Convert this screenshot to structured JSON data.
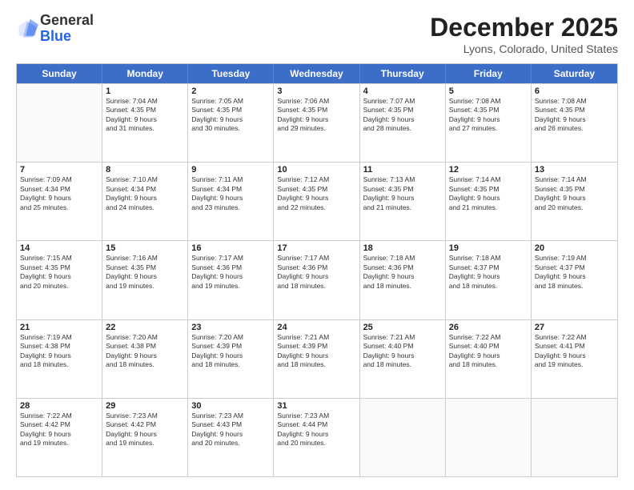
{
  "logo": {
    "line1": "General",
    "line2": "Blue"
  },
  "title": "December 2025",
  "location": "Lyons, Colorado, United States",
  "weekdays": [
    "Sunday",
    "Monday",
    "Tuesday",
    "Wednesday",
    "Thursday",
    "Friday",
    "Saturday"
  ],
  "weeks": [
    [
      {
        "day": "",
        "info": ""
      },
      {
        "day": "1",
        "info": "Sunrise: 7:04 AM\nSunset: 4:35 PM\nDaylight: 9 hours\nand 31 minutes."
      },
      {
        "day": "2",
        "info": "Sunrise: 7:05 AM\nSunset: 4:35 PM\nDaylight: 9 hours\nand 30 minutes."
      },
      {
        "day": "3",
        "info": "Sunrise: 7:06 AM\nSunset: 4:35 PM\nDaylight: 9 hours\nand 29 minutes."
      },
      {
        "day": "4",
        "info": "Sunrise: 7:07 AM\nSunset: 4:35 PM\nDaylight: 9 hours\nand 28 minutes."
      },
      {
        "day": "5",
        "info": "Sunrise: 7:08 AM\nSunset: 4:35 PM\nDaylight: 9 hours\nand 27 minutes."
      },
      {
        "day": "6",
        "info": "Sunrise: 7:08 AM\nSunset: 4:35 PM\nDaylight: 9 hours\nand 26 minutes."
      }
    ],
    [
      {
        "day": "7",
        "info": "Sunrise: 7:09 AM\nSunset: 4:34 PM\nDaylight: 9 hours\nand 25 minutes."
      },
      {
        "day": "8",
        "info": "Sunrise: 7:10 AM\nSunset: 4:34 PM\nDaylight: 9 hours\nand 24 minutes."
      },
      {
        "day": "9",
        "info": "Sunrise: 7:11 AM\nSunset: 4:34 PM\nDaylight: 9 hours\nand 23 minutes."
      },
      {
        "day": "10",
        "info": "Sunrise: 7:12 AM\nSunset: 4:35 PM\nDaylight: 9 hours\nand 22 minutes."
      },
      {
        "day": "11",
        "info": "Sunrise: 7:13 AM\nSunset: 4:35 PM\nDaylight: 9 hours\nand 21 minutes."
      },
      {
        "day": "12",
        "info": "Sunrise: 7:14 AM\nSunset: 4:35 PM\nDaylight: 9 hours\nand 21 minutes."
      },
      {
        "day": "13",
        "info": "Sunrise: 7:14 AM\nSunset: 4:35 PM\nDaylight: 9 hours\nand 20 minutes."
      }
    ],
    [
      {
        "day": "14",
        "info": "Sunrise: 7:15 AM\nSunset: 4:35 PM\nDaylight: 9 hours\nand 20 minutes."
      },
      {
        "day": "15",
        "info": "Sunrise: 7:16 AM\nSunset: 4:35 PM\nDaylight: 9 hours\nand 19 minutes."
      },
      {
        "day": "16",
        "info": "Sunrise: 7:17 AM\nSunset: 4:36 PM\nDaylight: 9 hours\nand 19 minutes."
      },
      {
        "day": "17",
        "info": "Sunrise: 7:17 AM\nSunset: 4:36 PM\nDaylight: 9 hours\nand 18 minutes."
      },
      {
        "day": "18",
        "info": "Sunrise: 7:18 AM\nSunset: 4:36 PM\nDaylight: 9 hours\nand 18 minutes."
      },
      {
        "day": "19",
        "info": "Sunrise: 7:18 AM\nSunset: 4:37 PM\nDaylight: 9 hours\nand 18 minutes."
      },
      {
        "day": "20",
        "info": "Sunrise: 7:19 AM\nSunset: 4:37 PM\nDaylight: 9 hours\nand 18 minutes."
      }
    ],
    [
      {
        "day": "21",
        "info": "Sunrise: 7:19 AM\nSunset: 4:38 PM\nDaylight: 9 hours\nand 18 minutes."
      },
      {
        "day": "22",
        "info": "Sunrise: 7:20 AM\nSunset: 4:38 PM\nDaylight: 9 hours\nand 18 minutes."
      },
      {
        "day": "23",
        "info": "Sunrise: 7:20 AM\nSunset: 4:39 PM\nDaylight: 9 hours\nand 18 minutes."
      },
      {
        "day": "24",
        "info": "Sunrise: 7:21 AM\nSunset: 4:39 PM\nDaylight: 9 hours\nand 18 minutes."
      },
      {
        "day": "25",
        "info": "Sunrise: 7:21 AM\nSunset: 4:40 PM\nDaylight: 9 hours\nand 18 minutes."
      },
      {
        "day": "26",
        "info": "Sunrise: 7:22 AM\nSunset: 4:40 PM\nDaylight: 9 hours\nand 18 minutes."
      },
      {
        "day": "27",
        "info": "Sunrise: 7:22 AM\nSunset: 4:41 PM\nDaylight: 9 hours\nand 19 minutes."
      }
    ],
    [
      {
        "day": "28",
        "info": "Sunrise: 7:22 AM\nSunset: 4:42 PM\nDaylight: 9 hours\nand 19 minutes."
      },
      {
        "day": "29",
        "info": "Sunrise: 7:23 AM\nSunset: 4:42 PM\nDaylight: 9 hours\nand 19 minutes."
      },
      {
        "day": "30",
        "info": "Sunrise: 7:23 AM\nSunset: 4:43 PM\nDaylight: 9 hours\nand 20 minutes."
      },
      {
        "day": "31",
        "info": "Sunrise: 7:23 AM\nSunset: 4:44 PM\nDaylight: 9 hours\nand 20 minutes."
      },
      {
        "day": "",
        "info": ""
      },
      {
        "day": "",
        "info": ""
      },
      {
        "day": "",
        "info": ""
      }
    ]
  ]
}
